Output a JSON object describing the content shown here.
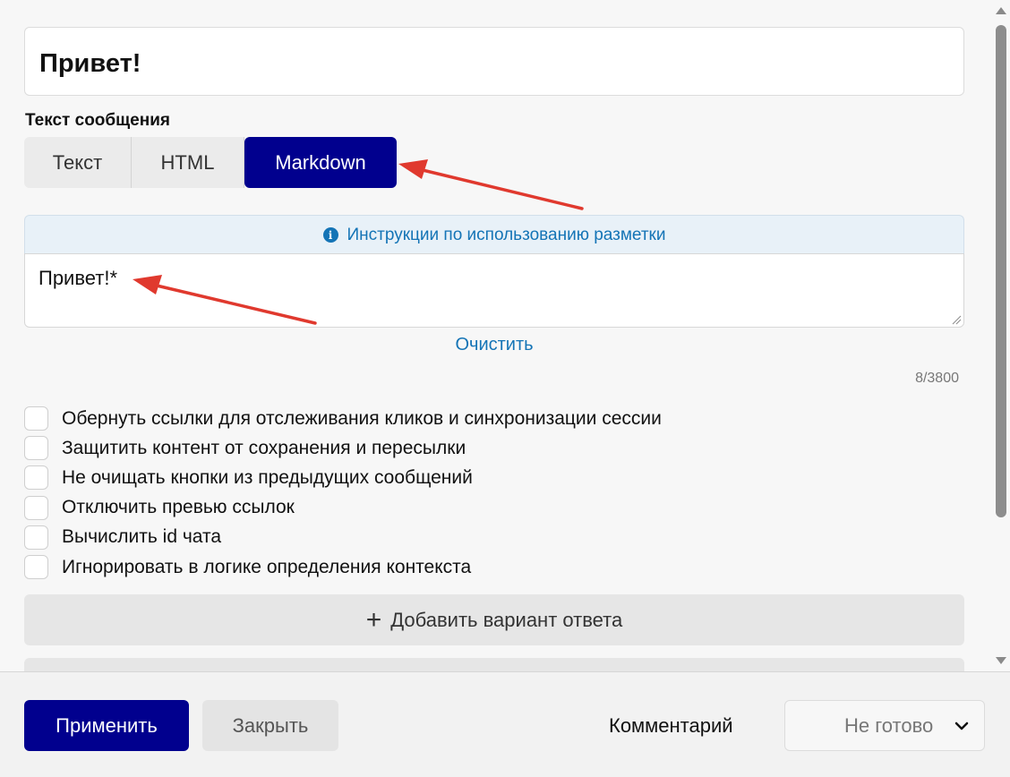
{
  "message": {
    "title": "Привет!",
    "section_label": "Текст сообщения",
    "format_tabs": [
      "Текст",
      "HTML",
      "Markdown"
    ],
    "active_format": "Markdown",
    "instructions_link": "Инструкции по использованию разметки",
    "editor_text": "Привет!*",
    "clear_label": "Очистить",
    "char_counter": "8/3800"
  },
  "options": [
    "Обернуть ссылки для отслеживания кликов и синхронизации сессии",
    "Защитить контент от сохранения и пересылки",
    "Не очищать кнопки из предыдущих сообщений",
    "Отключить превью ссылок",
    "Вычислить id чата",
    "Игнорировать в логике определения контекста"
  ],
  "add_answer_label": "Добавить вариант ответа",
  "footer": {
    "apply_label": "Применить",
    "close_label": "Закрыть",
    "comment_label": "Комментарий",
    "status_value": "Не готово"
  },
  "colors": {
    "accent": "#01008e",
    "link": "#1474b6",
    "annotation_arrow": "#e0392e"
  },
  "icons": {
    "info": "info-icon",
    "plus": "plus-icon",
    "chevron": "chevron-down-icon"
  }
}
